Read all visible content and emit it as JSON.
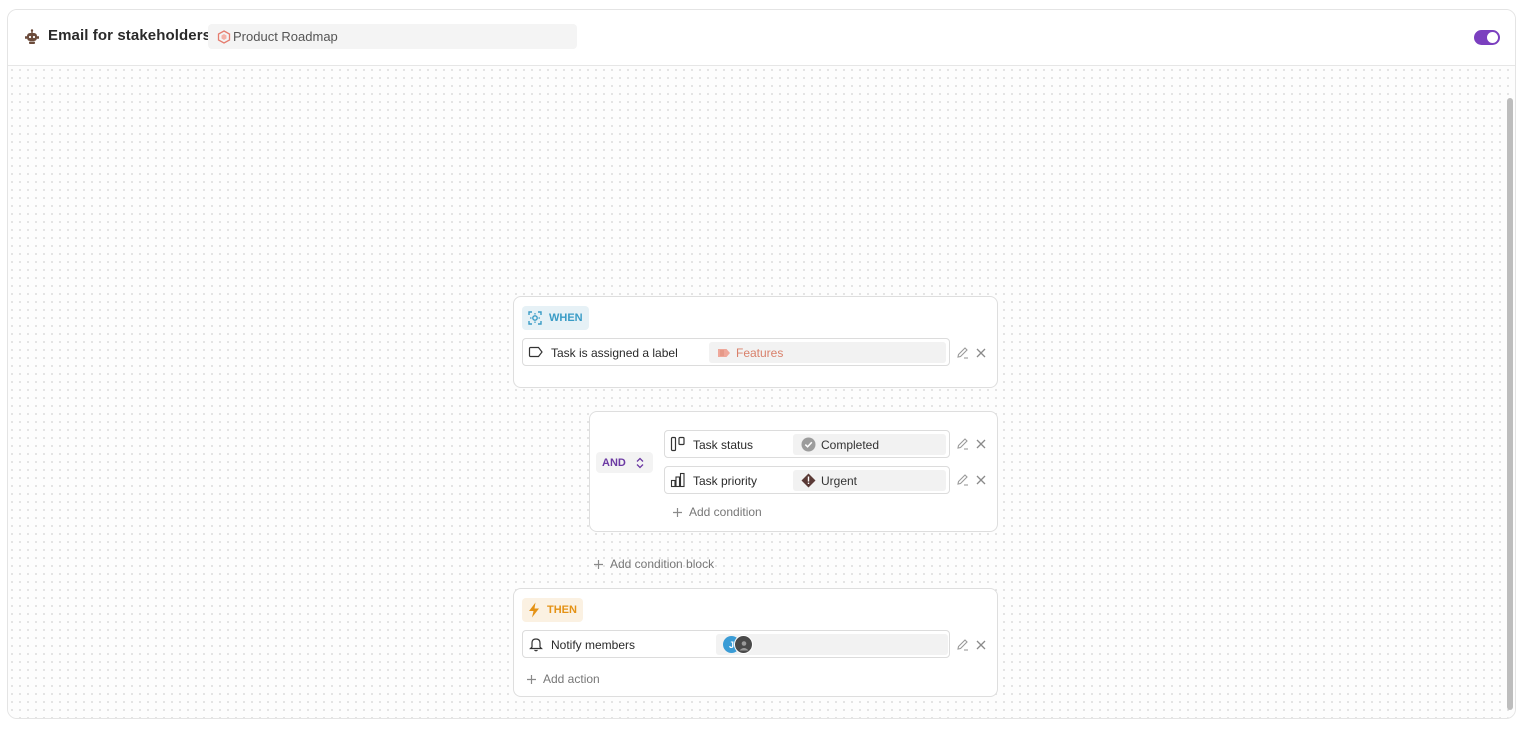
{
  "header": {
    "title": "Email for stakeholders",
    "project": "Product Roadmap",
    "toggle_on": true,
    "accent_color": "#7b3fbf"
  },
  "when_block": {
    "badge": "WHEN",
    "trigger": {
      "icon": "tag-outline-icon",
      "label": "Task is assigned a label",
      "value": "Features",
      "value_color": "#d9806a"
    }
  },
  "condition_block": {
    "operator": "AND",
    "conditions": [
      {
        "icon": "status-columns-icon",
        "label": "Task status",
        "value": "Completed",
        "value_icon": "completed-check-icon"
      },
      {
        "icon": "priority-bars-icon",
        "label": "Task priority",
        "value": "Urgent",
        "value_icon": "urgent-priority-icon"
      }
    ],
    "add_condition": "Add condition"
  },
  "add_condition_block": "Add condition block",
  "then_block": {
    "badge": "THEN",
    "action": {
      "icon": "bell-icon",
      "label": "Notify members",
      "members": [
        {
          "initial": "J",
          "color": "#3a9cd6"
        },
        {
          "initial": "",
          "color": "#4a4a4a"
        }
      ]
    },
    "add_action": "Add action"
  }
}
